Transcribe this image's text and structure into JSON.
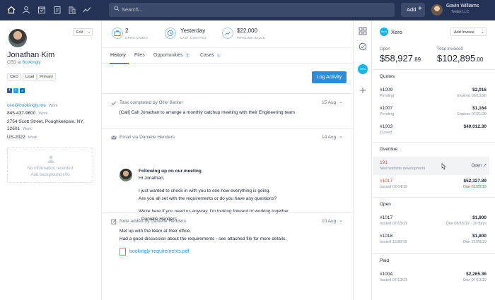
{
  "nav": {
    "icons": [
      "home-icon",
      "person-icon",
      "calendar-icon",
      "clipboard-icon",
      "building-icon",
      "chart-icon"
    ],
    "search_placeholder": "Search...",
    "add_label": "Add",
    "add_symbol": "+",
    "user_name": "Gavin Williams",
    "user_org": "Twitter LLC"
  },
  "contact": {
    "edit_label": "Edit",
    "name": "Jonathan Kim",
    "role_prefix": "CEO at",
    "company": "Bookingly",
    "tags": [
      "CEO",
      "Lead",
      "Primary"
    ],
    "social": [
      "f",
      "t",
      "in"
    ],
    "email": "ceo@bookingly.me",
    "email_type": "Work",
    "phone": "845-437-9600",
    "phone_type": "Work",
    "address_line1": "2754 Scott Street, Poughkeepsie, NY,",
    "address_line2": "12601",
    "address_type": "Work",
    "country": "US-2022",
    "country_type": "Work",
    "background_empty": "No information recorded",
    "background_add": "Add background info"
  },
  "stats": [
    {
      "value": "2",
      "label": "OPEN CASES",
      "icon": "briefcase-icon"
    },
    {
      "value": "Yesterday",
      "label": "LAST CONTACT",
      "icon": "clock-icon"
    },
    {
      "value": "$22,000",
      "label": "PIPELINE VALUE",
      "icon": "trend-icon"
    }
  ],
  "tabs": [
    {
      "label": "History",
      "count": ""
    },
    {
      "label": "Files",
      "count": ""
    },
    {
      "label": "Opportunities",
      "count": "2"
    },
    {
      "label": "Cases",
      "count": "1"
    }
  ],
  "log_activity": "Log Activity",
  "activities": {
    "task": {
      "title": "Task completed by Ollie Barker",
      "date": "15 Aug",
      "text": "[Call] Call Jonathan to arrange a monthly catchup meeting with their Engineering team"
    },
    "email": {
      "title": "Email via Danielle Henders",
      "date": "14 Aug",
      "subject": "Following up on our meeting",
      "greeting": "Hi Jonathan,",
      "line1": "I just wanted to check in with you to see how everything is going.",
      "line2": "Are you all set with the requirements or do you have any questions?",
      "line3": "We're here if you need us anyway. I'm looking forward to working together.",
      "signoff": "- Danielle Henders"
    },
    "note": {
      "title": "Note added by Danielle Henders",
      "date": "10 Aug",
      "line1": "Met up with the team at their office.",
      "line2": "Had a good discussion about the requirements - see attached file for more details.",
      "file": "bookingly-requirements.pdf"
    }
  },
  "xero": {
    "title": "Xero",
    "add_invoice": "Add Invoice",
    "open_label": "Open",
    "open_main": "$58,927",
    "open_cents": ".89",
    "invoiced_label": "Total Invoiced",
    "invoiced_main": "$102,895",
    "invoiced_cents": ".00",
    "open_link": "Open",
    "sections": {
      "quotes": {
        "heading": "Quotes",
        "items": [
          {
            "num": "#1009",
            "status": "Pending",
            "amount": "$2,016",
            "note": "Expired 06/13/20"
          },
          {
            "num": "#1007",
            "status": "Pending",
            "amount": "$1,164",
            "note": "Expires 07/21/20"
          },
          {
            "num": "#1003",
            "status": "Closed",
            "amount": "$40,012.30",
            "note": ""
          }
        ]
      },
      "overdue": {
        "heading": "Overdue",
        "items": [
          {
            "num": "191",
            "status": "New website development",
            "amount": "",
            "note": ""
          },
          {
            "num": "#1017",
            "status": "Issued 02/04/19",
            "amount": "$52,327.89",
            "note": "Due 02/20/19"
          }
        ]
      },
      "open": {
        "heading": "Open",
        "items": [
          {
            "num": "#1017",
            "status": "Issued 07/15/19",
            "amount": "$1,800",
            "note": "Due 08/15/19 · 29 days"
          },
          {
            "num": "#1018",
            "status": "Issued 11/28/19",
            "amount": "$1,800",
            "note": "Due 12/28/19"
          }
        ]
      },
      "paid": {
        "heading": "Paid",
        "items": [
          {
            "num": "#1004",
            "status": "Issued 07/13/19",
            "amount": "$2,265.36",
            "note": "Due 07/13/19"
          }
        ]
      }
    }
  },
  "colors": {
    "nav_bg": "#243355",
    "accent": "#3a8ed0",
    "button": "#2f8ad8",
    "danger": "#e0453a",
    "xero": "#13b5ea"
  }
}
